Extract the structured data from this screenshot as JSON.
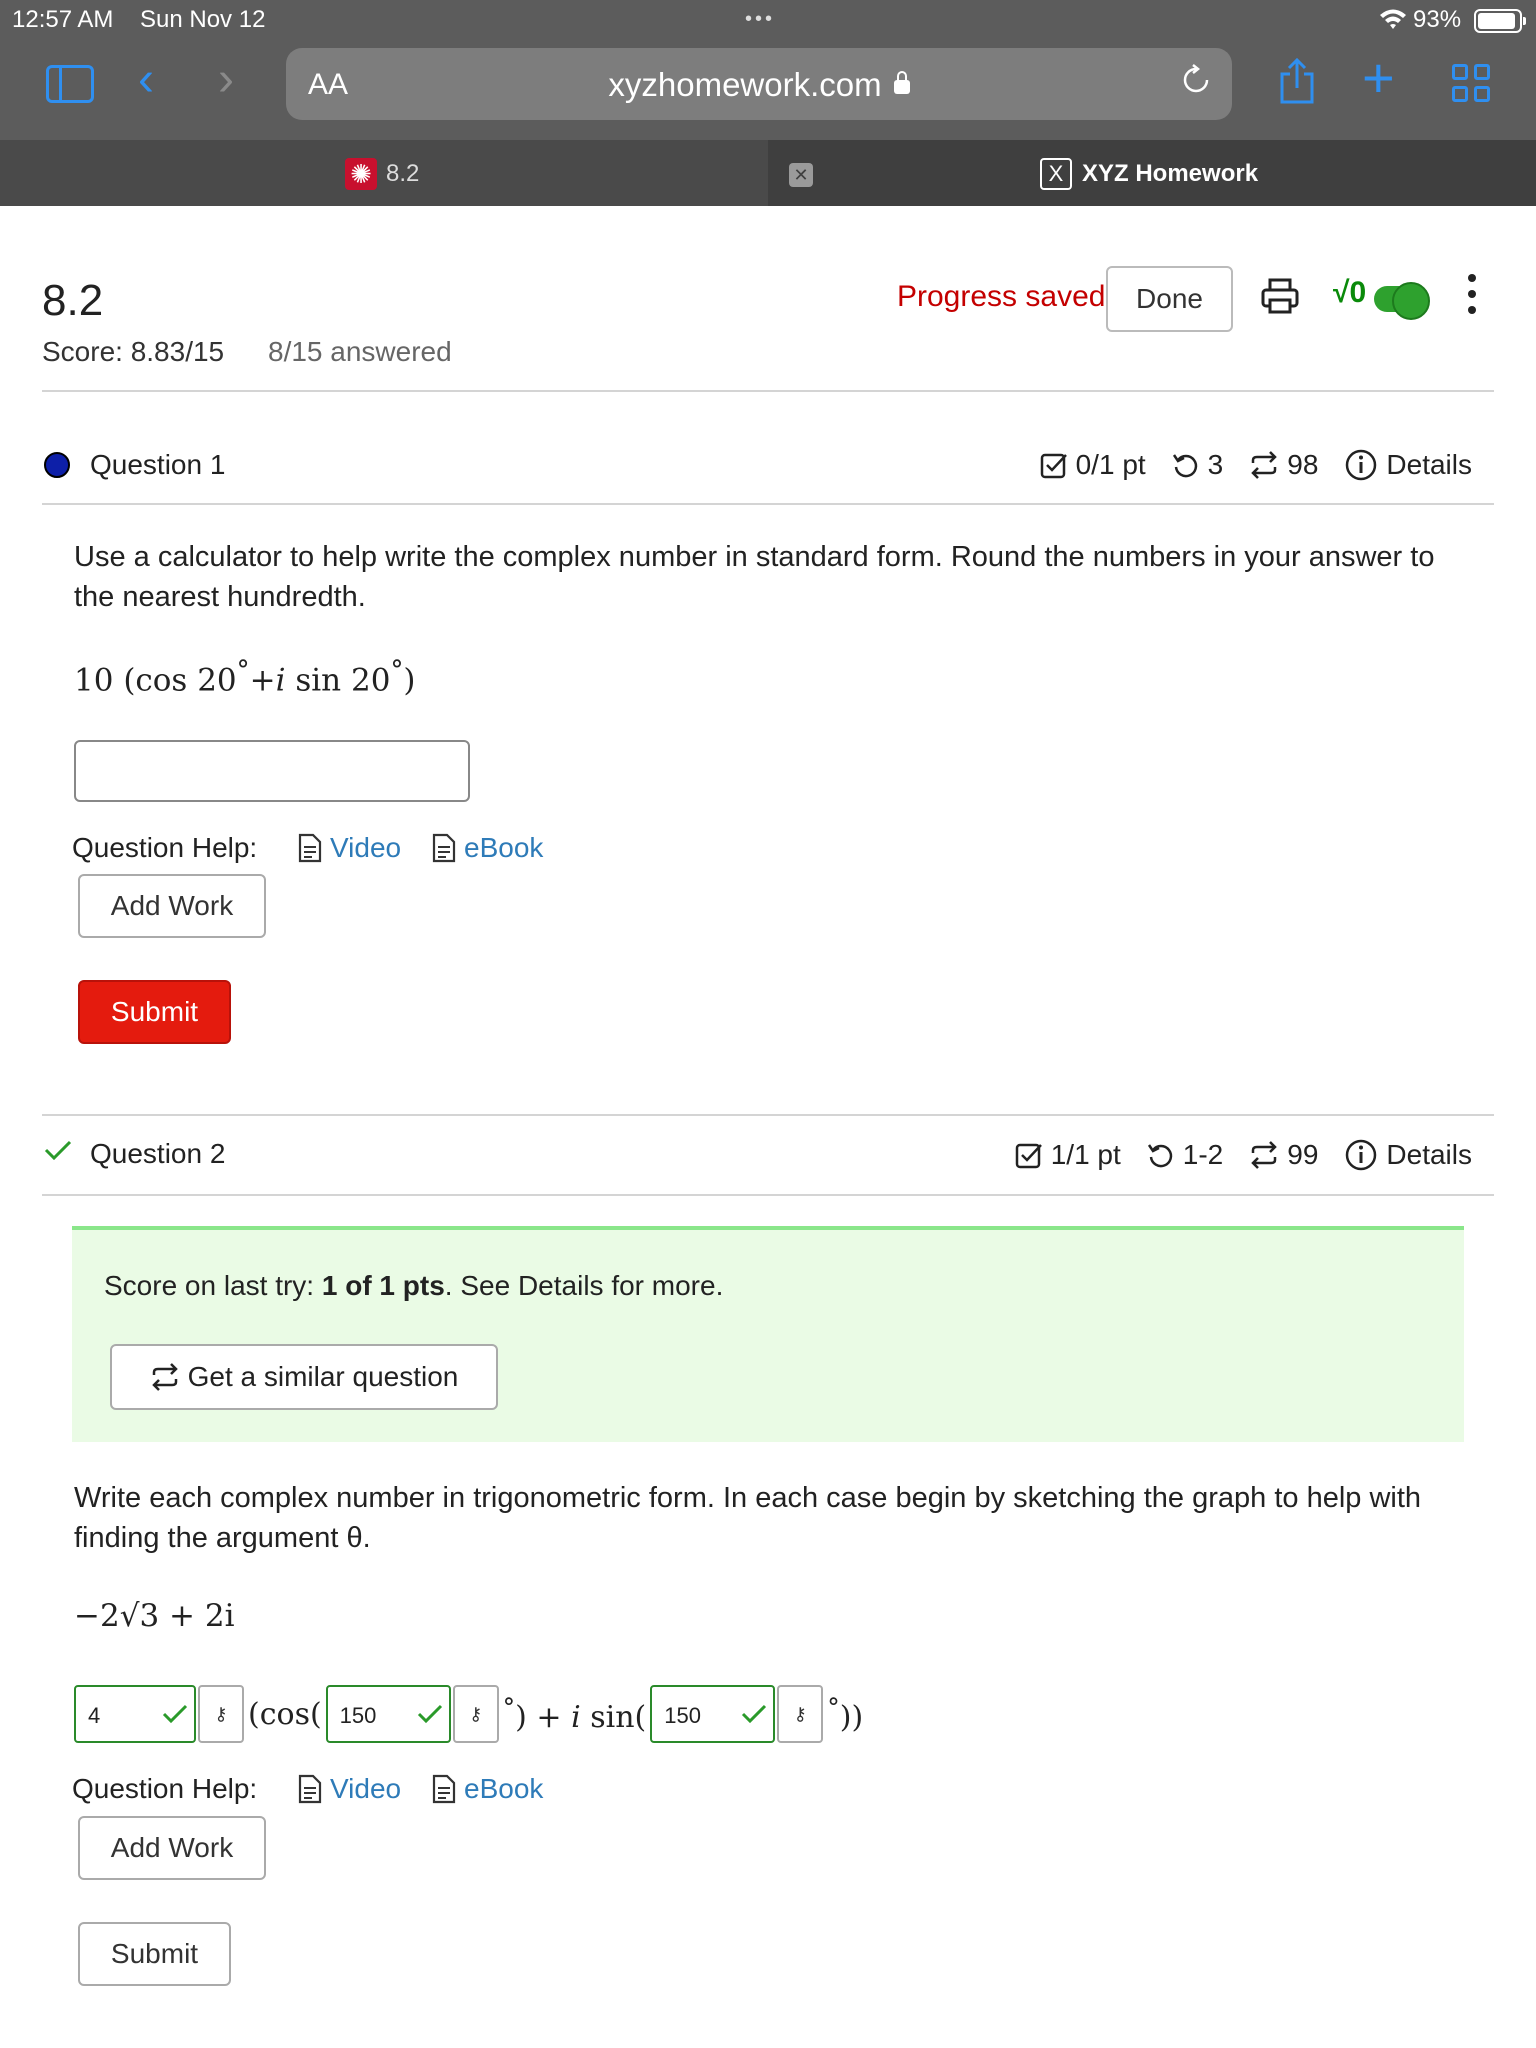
{
  "status_bar": {
    "time": "12:57 AM",
    "date": "Sun Nov 12",
    "dots": "•••",
    "battery": "93%"
  },
  "browser": {
    "text_size_label": "AA",
    "url": "xyzhomework.com",
    "tabs": [
      {
        "label": "8.2",
        "active": true
      },
      {
        "label": "XYZ Homework",
        "favicon_letter": "X",
        "active": false
      }
    ],
    "close_glyph": "✕"
  },
  "header": {
    "title": "8.2",
    "score": "Score: 8.83/15",
    "answered": "8/15 answered",
    "progress": "Progress saved",
    "done_label": "Done",
    "sqrt_label": "√0"
  },
  "questions": [
    {
      "title": "Question 1",
      "status": "current",
      "points": "0/1 pt",
      "retries": "3",
      "similar_count": "98",
      "details_label": "Details",
      "prompt": "Use a calculator to help write the complex number in standard form. Round the numbers in your answer to the nearest hundredth.",
      "math": {
        "coef": "10",
        "open": "(cos 20",
        "deg": "°",
        "plus": "+",
        "i": "i",
        "sin": " sin 20",
        "close": ")"
      },
      "answer_value": "",
      "help_label": "Question Help:",
      "video_label": "Video",
      "ebook_label": "eBook",
      "add_work_label": "Add Work",
      "submit_label": "Submit"
    },
    {
      "title": "Question 2",
      "status": "correct",
      "points": "1/1 pt",
      "retries": "1-2",
      "similar_count": "99",
      "details_label": "Details",
      "last_try_prefix": "Score on last try: ",
      "last_try_score": "1 of 1 pts",
      "last_try_suffix": ". See Details for more.",
      "similar_label": "Get a similar question",
      "prompt": "Write each complex number in trigonometric form. In each case begin by sketching the graph to help with finding the argument θ.",
      "math": "−2√3 + 2i",
      "answers": [
        "4",
        "150",
        "150"
      ],
      "help_label": "Question Help:",
      "video_label": "Video",
      "ebook_label": "eBook",
      "add_work_label": "Add Work",
      "submit_label": "Submit"
    }
  ],
  "colors": {
    "accent": "#2f8ff0",
    "submit": "#e41b0e",
    "correct": "#2a8a2a",
    "progress": "#c40000",
    "link": "#2e7bb8"
  }
}
